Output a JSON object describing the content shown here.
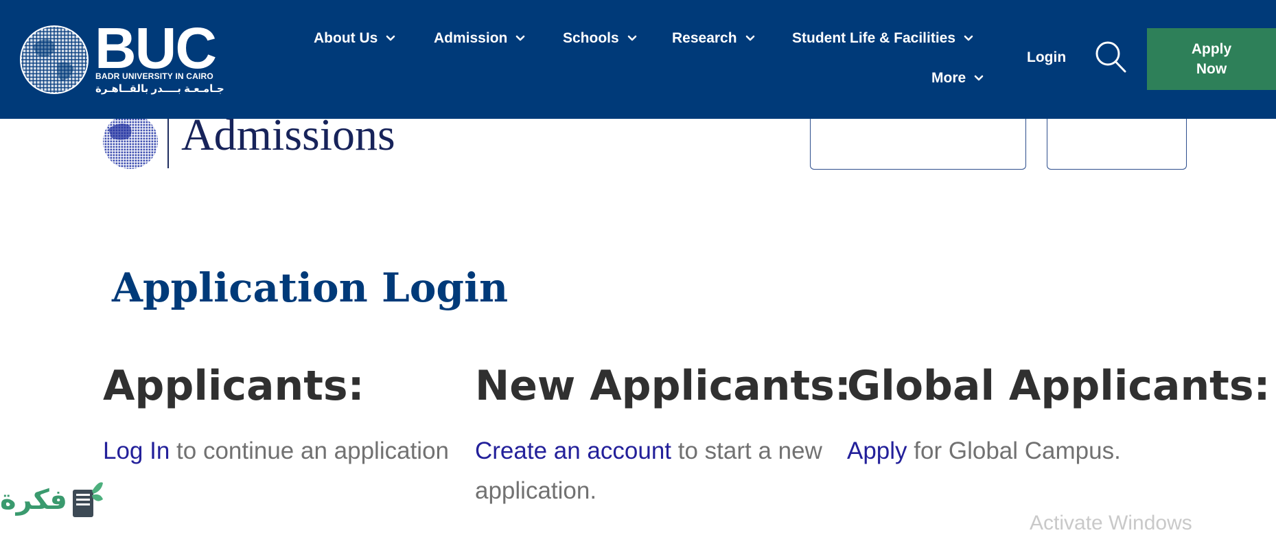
{
  "header": {
    "logo": {
      "brand": "BUC",
      "subtitle": "BADR UNIVERSITY IN CAIRO",
      "arabic": "جـامـعـة بــــدر بالقــاهـرة"
    },
    "nav": [
      {
        "label": "About Us"
      },
      {
        "label": "Admission"
      },
      {
        "label": "Schools"
      },
      {
        "label": "Research"
      },
      {
        "label": "Student Life & Facilities"
      },
      {
        "label": "More"
      }
    ],
    "login_label": "Login",
    "apply_label": "Apply Now"
  },
  "banner": {
    "title": "Admissions"
  },
  "main": {
    "title": "Application Login",
    "columns": [
      {
        "heading": "Applicants:",
        "link": "Log In",
        "text": " to continue an application"
      },
      {
        "heading": "New Applicants:",
        "link": "Create an account",
        "text": " to start a new application."
      },
      {
        "heading": "Global Applicants:",
        "link": "Apply",
        "text": " for Global Campus."
      }
    ]
  },
  "overlay": {
    "watermark_text": "فكرة",
    "activate_text": "Activate Windows"
  },
  "colors": {
    "header_bg": "#003a79",
    "apply_bg": "#2e8059",
    "title": "#003a79",
    "link": "#23209a",
    "body_text": "#717171"
  }
}
